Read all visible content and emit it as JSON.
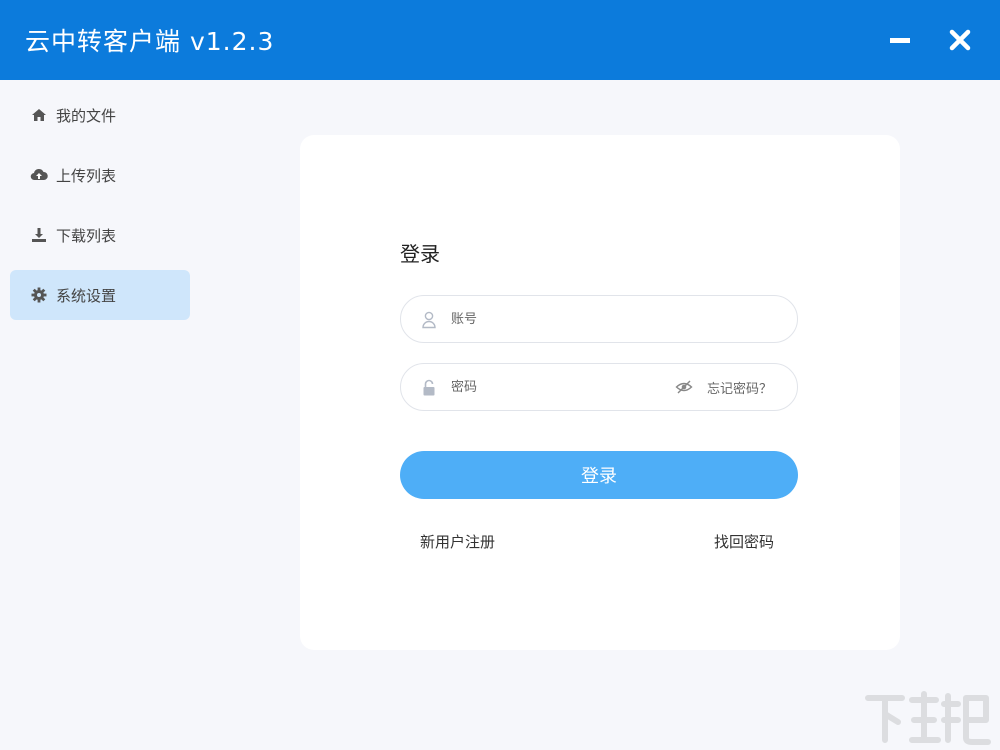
{
  "window": {
    "title": "云中转客户端 v1.2.3",
    "accent_color": "#0c7bdc",
    "minimize_icon": "minimize-icon",
    "close_icon": "close-icon"
  },
  "sidebar": {
    "items": [
      {
        "label": "我的文件",
        "icon": "home-icon",
        "active": false
      },
      {
        "label": "上传列表",
        "icon": "cloud-upload-icon",
        "active": false
      },
      {
        "label": "下载列表",
        "icon": "download-icon",
        "active": false
      },
      {
        "label": "系统设置",
        "icon": "gear-icon",
        "active": true
      }
    ]
  },
  "login": {
    "title": "登录",
    "account": {
      "placeholder": "账号",
      "value": "",
      "icon": "user-icon"
    },
    "password": {
      "placeholder": "密码",
      "value": "",
      "icon": "lock-icon",
      "toggle_icon": "eye-off-icon",
      "forgot_label": "忘记密码？"
    },
    "submit_label": "登录",
    "button_color": "#4eaef7",
    "register_label": "新用户注册",
    "recover_label": "找回密码"
  }
}
